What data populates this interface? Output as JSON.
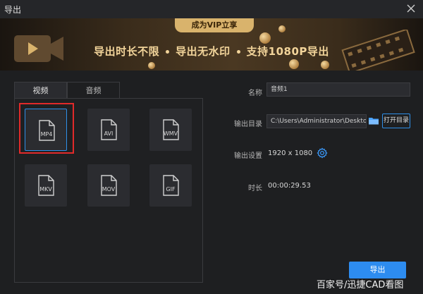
{
  "window": {
    "title": "导出"
  },
  "banner": {
    "vip_label": "成为VIP立享",
    "feature_1": "导出时长不限",
    "feature_2": "导出无水印",
    "feature_3": "支持1080P导出"
  },
  "tabs": [
    {
      "label": "视频",
      "active": true
    },
    {
      "label": "音频",
      "active": false
    }
  ],
  "formats": [
    {
      "label": "MP4",
      "selected": true
    },
    {
      "label": "AVI",
      "selected": false
    },
    {
      "label": "WMV",
      "selected": false
    },
    {
      "label": "MKV",
      "selected": false
    },
    {
      "label": "MOV",
      "selected": false
    },
    {
      "label": "GIF",
      "selected": false
    }
  ],
  "settings": {
    "name_label": "名称",
    "name_value": "音频1",
    "dir_label": "输出目录",
    "dir_value": "C:\\Users\\Administrator\\Desktop\\",
    "open_dir_label": "打开目录",
    "output_settings_label": "输出设置",
    "resolution": "1920 x 1080",
    "duration_label": "时长",
    "duration_value": "00:00:29.53"
  },
  "export_button": "导出",
  "watermark": "百家号/迅捷CAD看图",
  "icons": {
    "close": "close-icon",
    "folder": "folder-icon",
    "gear": "gear-icon",
    "camera": "camera-icon",
    "film": "film-icon"
  },
  "colors": {
    "accent": "#2d8cf0",
    "banner_gold": "#f2d49a",
    "highlight_red": "#e12a2a"
  }
}
